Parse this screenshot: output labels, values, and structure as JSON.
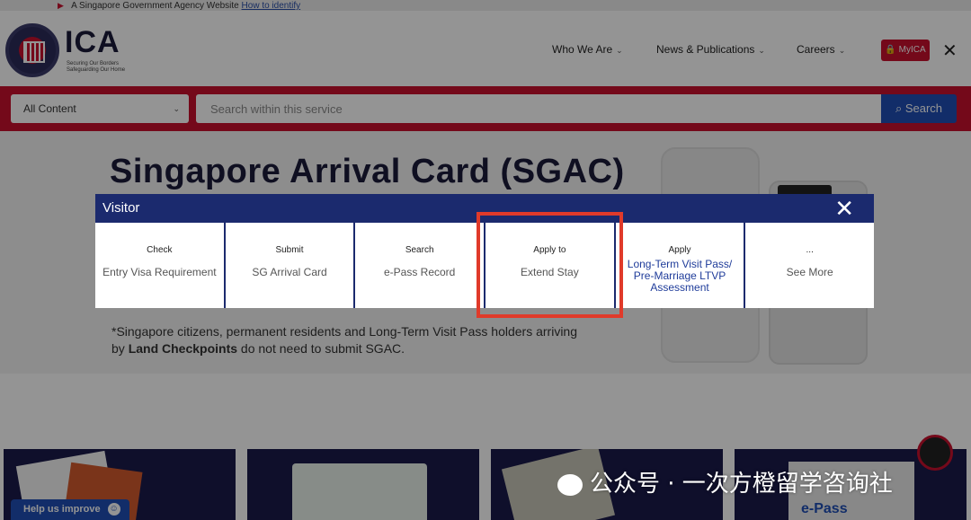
{
  "gov_bar": {
    "text": "A Singapore Government Agency Website",
    "link": "How to identify"
  },
  "header": {
    "logo": "ICA",
    "tagline": "Securing Our Borders Safeguarding Our Home",
    "nav": [
      {
        "label": "Who We Are"
      },
      {
        "label": "News & Publications"
      },
      {
        "label": "Careers"
      }
    ],
    "myica_label": "MyICA",
    "close_glyph": "✕"
  },
  "search": {
    "scope": "All Content",
    "placeholder": "Search within this service",
    "button_label": "Search"
  },
  "hero": {
    "title": "Singapore Arrival Card (SGAC)",
    "note_pre": "*Singapore citizens, permanent residents and Long-Term Visit Pass holders arriving by ",
    "note_bold": "Land Checkpoints",
    "note_post": " do not need to submit SGAC."
  },
  "modal": {
    "title": "Visitor",
    "close_glyph": "✕",
    "options": [
      {
        "verb": "Check",
        "label": "Entry Visa Requirement",
        "highlighted": false
      },
      {
        "verb": "Submit",
        "label": "SG Arrival Card",
        "highlighted": false
      },
      {
        "verb": "Search",
        "label": "e-Pass Record",
        "highlighted": false
      },
      {
        "verb": "Apply to",
        "label": "Extend Stay",
        "highlighted": true
      },
      {
        "verb": "Apply",
        "label": "Long-Term Visit Pass/ Pre-Marriage LTVP Assessment",
        "highlighted": false
      },
      {
        "verb": "...",
        "label": "See More",
        "highlighted": false
      }
    ]
  },
  "cards": {
    "card4_label": "e-Pass"
  },
  "help_button": "Help us improve",
  "watermark": "公众号 · 一次方橙留学咨询社",
  "colors": {
    "brand_red": "#c8102e",
    "navy": "#1b2a6e",
    "highlight": "#e03a2a",
    "link_blue": "#1f3c9a"
  }
}
